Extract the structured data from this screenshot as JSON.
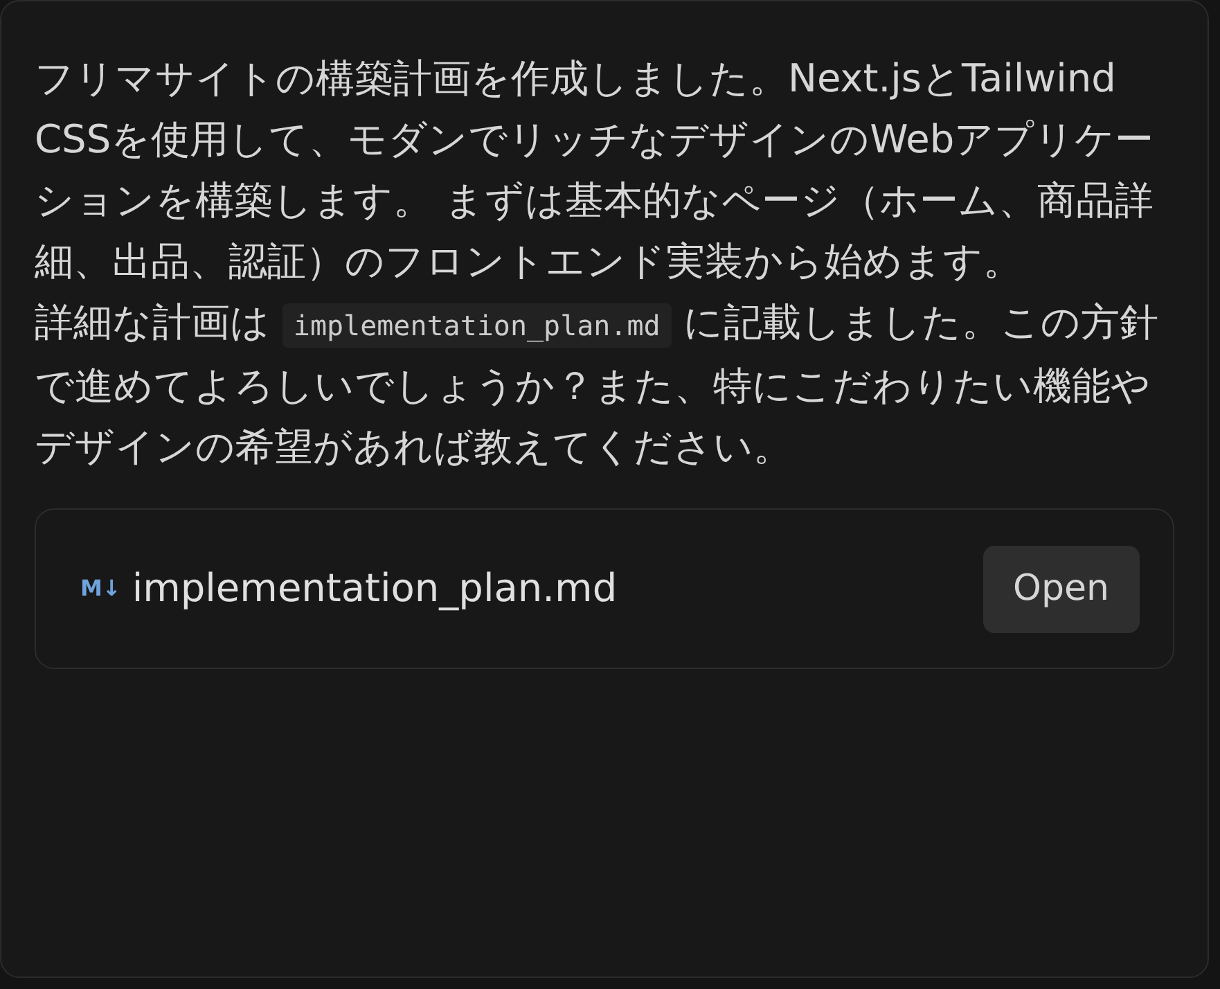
{
  "message": {
    "paragraph_1": "フリマサイトの構築計画を作成しました。Next.jsとTailwind CSSを使用して、モダンでリッチなデザインのWebアプリケーションを構築します。 まずは基本的なページ（ホーム、商品詳細、出品、認証）のフロントエンド実装から始めます。",
    "paragraph_2": {
      "before": "詳細な計画は ",
      "code": "implementation_plan.md",
      "after": " に記載しました。この方針で進めてよろしいでしょうか？また、特にこだわりたい機能やデザインの希望があれば教えてください。"
    }
  },
  "file": {
    "icon_text": "M↓",
    "name": "implementation_plan.md",
    "button": "Open"
  }
}
